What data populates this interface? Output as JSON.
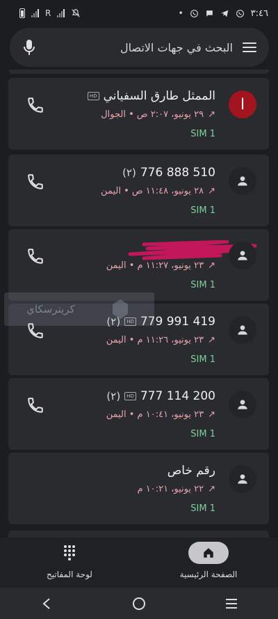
{
  "status_bar": {
    "time": "٣:٤٦",
    "carrier_label": "R",
    "icons": [
      "mute-icon",
      "signal-icon",
      "battery-icon",
      "whatsapp-icon",
      "telegram-icon",
      "chat-icon",
      "whatsapp-icon",
      "dot-icon"
    ]
  },
  "search": {
    "placeholder": "البحث في جهات الاتصال",
    "icons": [
      "mic-icon",
      "menu-icon"
    ]
  },
  "calls": [
    {
      "name": "الممثل طارق السفياني",
      "count": "",
      "hd": true,
      "avatar_letter": "ا",
      "meta": "٢٩ يونيو، ٢:٠٧ ص • الجوال",
      "sim": "SIM 1",
      "redacted": false
    },
    {
      "name": "776 888 510",
      "count": "(٢)",
      "hd": false,
      "avatar_letter": "",
      "meta": "٢٨ يونيو، ١١:٤٨ ص • اليمن",
      "sim": "SIM 1",
      "redacted": false
    },
    {
      "name": "",
      "count": "",
      "hd": false,
      "avatar_letter": "",
      "meta": "٢٣ يونيو، ١١:٢٧ م • اليمن",
      "sim": "SIM 1",
      "redacted": true
    },
    {
      "name": "779 991 419",
      "count": "(٢)",
      "hd": true,
      "avatar_letter": "",
      "meta": "٢٣ يونيو، ١١:٢٦ م • اليمن",
      "sim": "SIM 1",
      "redacted": false
    },
    {
      "name": "777 114 200",
      "count": "(٢)",
      "hd": true,
      "avatar_letter": "",
      "meta": "٢٣ يونيو، ١٠:٤١ م • اليمن",
      "sim": "SIM 1",
      "redacted": false
    },
    {
      "name": "رقم خاص",
      "count": "",
      "hd": false,
      "avatar_letter": "",
      "meta": "٢٢ يونيو، ١٠:٢١ م",
      "sim": "SIM 1",
      "redacted": false
    }
  ],
  "hd_label": "HD",
  "watermark": {
    "brand": "كريترسكاي"
  },
  "bottom_nav": {
    "home_label": "الصفحة الرئيسية",
    "keypad_label": "لوحة المفاتيح"
  },
  "colors": {
    "background": "#1c1d20",
    "card": "#2a2b2f",
    "missed": "#e9a4ad",
    "sim": "#7fd09a",
    "avatar_red": "#a3151e"
  }
}
